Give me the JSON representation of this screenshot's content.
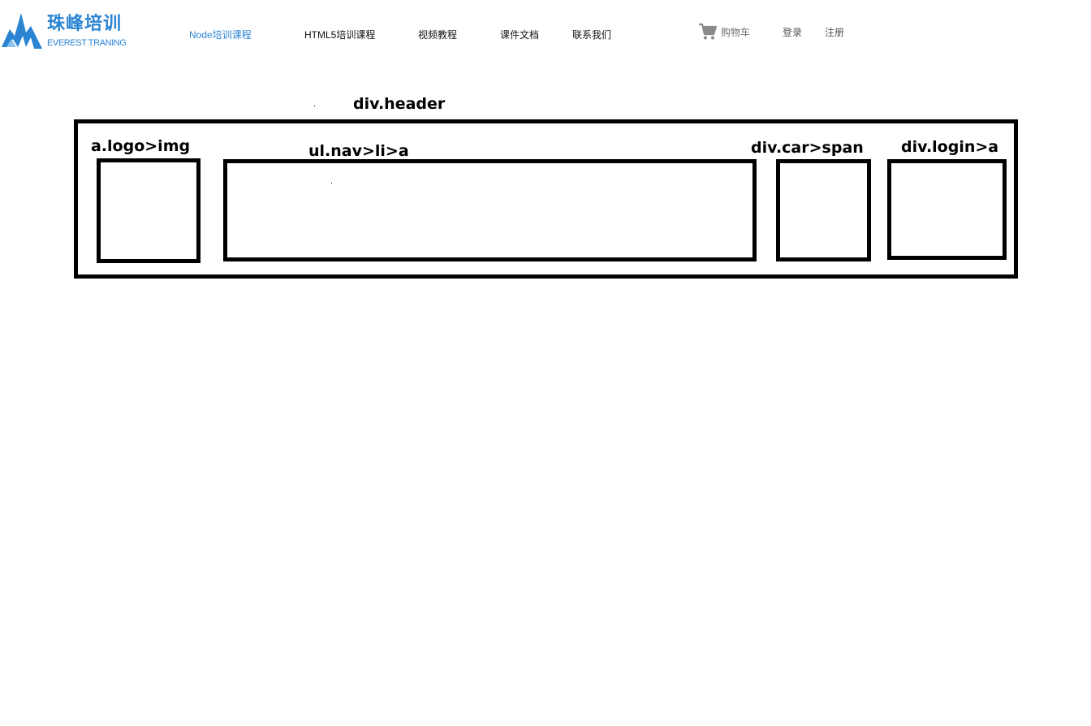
{
  "header": {
    "logo": {
      "name_cn": "珠峰培训",
      "name_en": "EVEREST TRANING"
    },
    "nav": [
      {
        "label": "Node培训课程",
        "active": true
      },
      {
        "label": "HTML5培训课程",
        "active": false
      },
      {
        "label": "视频教程",
        "active": false
      },
      {
        "label": "课件文档",
        "active": false
      },
      {
        "label": "联系我们",
        "active": false
      }
    ],
    "cart": {
      "label": "购物车",
      "icon": "cart-icon"
    },
    "login": {
      "login_label": "登录",
      "register_label": "注册"
    }
  },
  "wireframe": {
    "header_label": "div.header",
    "logo_label": "a.logo>img",
    "nav_label": "ul.nav>li>a",
    "car_label": "div.car>span",
    "login_label": "div.login>a"
  },
  "colors": {
    "brand": "#2a84d2",
    "nav_text": "#111111",
    "muted_text": "#6f6f6f",
    "wireframe_stroke": "#000000"
  }
}
